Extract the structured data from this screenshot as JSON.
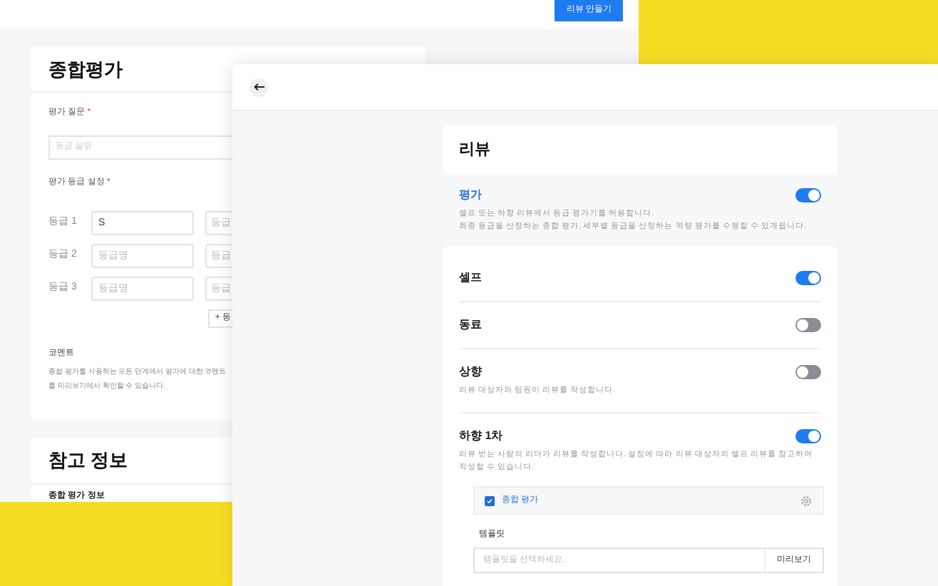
{
  "back_window": {
    "create_button": "리뷰 만들기",
    "overall_card": {
      "title": "종합평가",
      "question_label": "평가 질문",
      "question_required": "*",
      "question_placeholder": "등급 설명",
      "grade_label": "평가 등급 설정",
      "grade_required": "*",
      "grades": [
        {
          "label": "등급 1",
          "value": "S",
          "desc_placeholder": "등급"
        },
        {
          "label": "등급 2",
          "placeholder": "등급명",
          "desc_placeholder": "등급"
        },
        {
          "label": "등급 3",
          "placeholder": "등급명",
          "desc_placeholder": "등급"
        }
      ],
      "add_grade_button": "+ 등",
      "comment_title": "코멘트",
      "comment_text": "종합 평가를 사용하는 모든 단계에서 평가에 대한 코멘트를 미리보기에서 확인할 수 있습니다."
    },
    "reference_card": {
      "title": "참고 정보",
      "subtitle": "종합 평가 정보"
    }
  },
  "front_window": {
    "review_card": {
      "title": "리뷰",
      "sections": [
        {
          "kind": "highlight",
          "title": "평가",
          "on": true,
          "description": "셀프 또는 하향 리뷰에서 등급 평가기를 허용합니다.\n최종 등급을 산정하는 종합 평가, 세부별 등급을 산정하는 역량 평가를 수행할 수 있게됩니다."
        },
        {
          "kind": "plain",
          "title": "셀프",
          "on": true
        },
        {
          "kind": "plain",
          "title": "동료",
          "on": false
        },
        {
          "kind": "plain",
          "title": "상향",
          "on": false,
          "description": "리뷰 대상자의 팀원이 리뷰를 작성합니다."
        },
        {
          "kind": "plain",
          "title": "하향 1차",
          "on": true,
          "description": "리뷰 받는 사람의 리더가 리뷰를 작성합니다. 설정에 따라 리뷰 대상자의 셀프 리뷰를 참고하여 작성할 수 있습니다.",
          "option": {
            "label": "종합 평가",
            "checked": true
          },
          "template": {
            "label": "템플릿",
            "placeholder": "템플릿을 선택하세요.",
            "button": "미리보기"
          }
        }
      ]
    }
  }
}
